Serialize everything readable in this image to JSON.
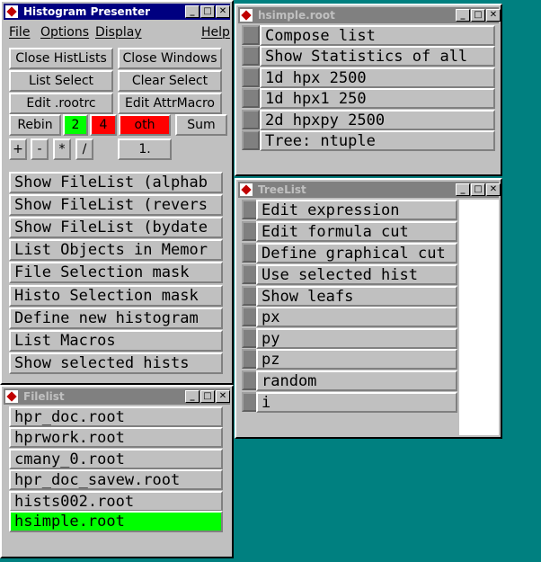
{
  "colors": {
    "desktop": "#008080",
    "green": "#00ff00",
    "red": "#ff0000"
  },
  "histogram_presenter": {
    "title": "Histogram Presenter",
    "menu": [
      "File",
      "Options",
      "Display",
      "Help"
    ],
    "buttons": {
      "close_histlists": "Close HistLists",
      "close_windows": "Close Windows",
      "list_select": "List Select",
      "clear_select": "Clear Select",
      "edit_rootrc": "Edit .rootrc",
      "edit_attrmacro": "Edit AttrMacro",
      "rebin": "Rebin",
      "count_2": "2",
      "count_4": "4",
      "oth": "oth",
      "sum": "Sum",
      "plus": "+",
      "minus": "-",
      "times": "*",
      "divide": "/",
      "factor": "1."
    },
    "actions": [
      "Show FileList (alphab",
      "Show FileList (revers",
      "Show FileList (bydate",
      "List Objects in Memor",
      "File Selection mask",
      "Histo Selection mask",
      "Define new histogram",
      "List Macros",
      "Show selected hists"
    ]
  },
  "filelist": {
    "title": "Filelist",
    "files": [
      "hpr_doc.root",
      "hprwork.root",
      "cmany_0.root",
      "hpr_doc_savew.root",
      "hists002.root",
      "hsimple.root"
    ],
    "selected_index": 5
  },
  "hsimple": {
    "title": "hsimple.root",
    "items": [
      "Compose list",
      "Show Statistics of all",
      "1d hpx 2500",
      "1d hpx1 250",
      "2d hpxpy 2500",
      "Tree: ntuple"
    ]
  },
  "treelist": {
    "title": "TreeList",
    "items": [
      "Edit expression",
      "Edit formula cut",
      "Define graphical cut",
      "Use selected hist",
      "Show leafs",
      "px",
      "py",
      "pz",
      "random",
      "i"
    ]
  },
  "window_buttons": {
    "minimize": "_",
    "maximize": "□",
    "close": "✕"
  }
}
